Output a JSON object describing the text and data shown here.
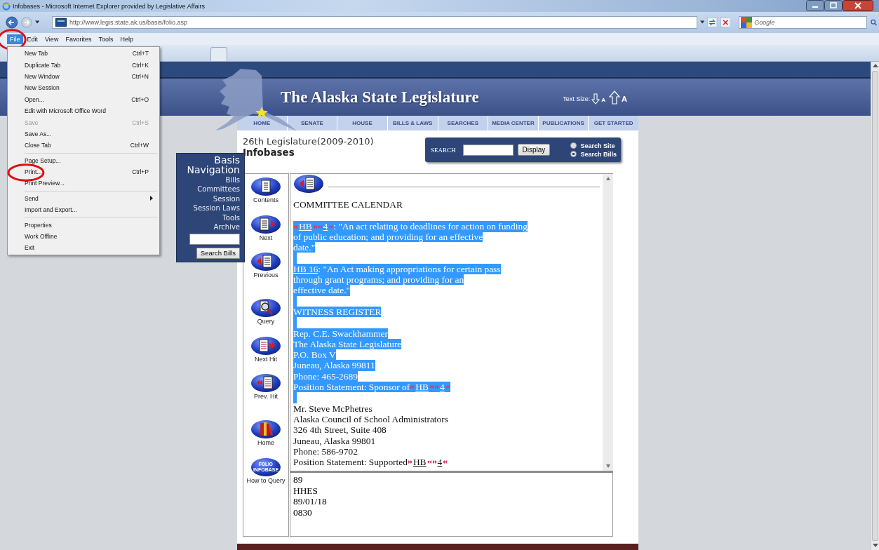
{
  "window": {
    "title": "Infobases - Microsoft Internet Explorer provided by Legislative Affairs"
  },
  "address_bar": {
    "url": "http://www.legis.state.ak.us/basis/folio.asp"
  },
  "search_box": {
    "placeholder": "Google"
  },
  "menu_bar": [
    {
      "label": "File",
      "selected": true,
      "circled": true
    },
    {
      "label": "Edit",
      "selected": false,
      "circled": false
    },
    {
      "label": "View",
      "selected": false,
      "circled": false
    },
    {
      "label": "Favorites",
      "selected": false,
      "circled": false
    },
    {
      "label": "Tools",
      "selected": false,
      "circled": false
    },
    {
      "label": "Help",
      "selected": false,
      "circled": false
    }
  ],
  "file_menu": {
    "groups": [
      [
        {
          "label": "New Tab",
          "shortcut": "Ctrl+T",
          "disabled": false,
          "submenu": false,
          "circled": false
        },
        {
          "label": "Duplicate Tab",
          "shortcut": "Ctrl+K",
          "disabled": false,
          "submenu": false,
          "circled": false
        },
        {
          "label": "New Window",
          "shortcut": "Ctrl+N",
          "disabled": false,
          "submenu": false,
          "circled": false
        },
        {
          "label": "New Session",
          "disabled": false,
          "submenu": false,
          "circled": false
        },
        {
          "label": "Open...",
          "shortcut": "Ctrl+O",
          "disabled": false,
          "submenu": false,
          "circled": false
        },
        {
          "label": "Edit with Microsoft Office Word",
          "disabled": false,
          "submenu": false,
          "circled": false
        },
        {
          "label": "Save",
          "shortcut": "Ctrl+S",
          "disabled": true,
          "submenu": false,
          "circled": false
        },
        {
          "label": "Save As...",
          "disabled": false,
          "submenu": false,
          "circled": false
        },
        {
          "label": "Close Tab",
          "shortcut": "Ctrl+W",
          "disabled": false,
          "submenu": false,
          "circled": false
        }
      ],
      [
        {
          "label": "Page Setup...",
          "disabled": false,
          "submenu": false,
          "circled": false
        },
        {
          "label": "Print...",
          "shortcut": "Ctrl+P",
          "disabled": false,
          "submenu": false,
          "circled": true
        },
        {
          "label": "Print Preview...",
          "disabled": false,
          "submenu": false,
          "circled": false
        }
      ],
      [
        {
          "label": "Send",
          "disabled": false,
          "submenu": true,
          "circled": false
        },
        {
          "label": "Import and Export...",
          "disabled": false,
          "submenu": false,
          "circled": false
        }
      ],
      [
        {
          "label": "Properties",
          "disabled": false,
          "submenu": false,
          "circled": false
        },
        {
          "label": "Work Offline",
          "disabled": false,
          "submenu": false,
          "circled": false
        },
        {
          "label": "Exit",
          "disabled": false,
          "submenu": false,
          "circled": false
        }
      ]
    ]
  },
  "site": {
    "title": "The Alaska State Legislature",
    "text_size": {
      "label": "Text Size:",
      "smaller": "A",
      "larger": "A"
    },
    "nav": [
      "HOME",
      "SENATE",
      "HOUSE",
      "BILLS & LAWS",
      "SEARCHES",
      "MEDIA CENTER",
      "PUBLICATIONS",
      "GET STARTED"
    ],
    "legislature": "26th Legislature(2009-2010)",
    "heading": "Infobases",
    "search": {
      "label": "SEARCH",
      "button": "Display",
      "options": [
        {
          "label": "Search Site",
          "selected": false
        },
        {
          "label": "Search Bills",
          "selected": true
        }
      ]
    }
  },
  "basis_navigation": {
    "title": "Basis Navigation",
    "links": [
      "Bills",
      "Committees",
      "Session",
      "Session Laws",
      "Tools",
      "Archive"
    ],
    "button": "Search Bills"
  },
  "tools": [
    {
      "kind": "contents",
      "label": "Contents"
    },
    {
      "kind": "next",
      "label": "Next"
    },
    {
      "kind": "previous",
      "label": "Previous"
    },
    {
      "kind": "query",
      "label": "Query"
    },
    {
      "kind": "next-hit",
      "label": "Next Hit"
    },
    {
      "kind": "prev-hit",
      "label": "Prev. Hit"
    },
    {
      "kind": "home",
      "label": "Home"
    },
    {
      "kind": "folio",
      "label": "How to Query",
      "logo_lines": [
        "FOLIO",
        "INFOBASE"
      ]
    }
  ],
  "document": {
    "lines": [
      {
        "selected": false,
        "segments": [
          {
            "kind": "text",
            "text": "COMMITTEE CALENDAR"
          }
        ]
      },
      {
        "selected": false
      },
      {
        "selected": true,
        "segments": [
          {
            "kind": "hit-open"
          },
          {
            "kind": "link",
            "text": "HB"
          },
          {
            "kind": "hit-close"
          },
          {
            "kind": "hit-open"
          },
          {
            "kind": "link",
            "text": "4"
          },
          {
            "kind": "hit-close"
          },
          {
            "kind": "text",
            "text": ": \"An act relating to deadlines for action on funding"
          }
        ]
      },
      {
        "selected": true,
        "segments": [
          {
            "kind": "text",
            "text": "of public education; and providing for an effective"
          }
        ]
      },
      {
        "selected": true,
        "segments": [
          {
            "kind": "text",
            "text": "date.\""
          }
        ]
      },
      {
        "selected": true
      },
      {
        "selected": true,
        "segments": [
          {
            "kind": "link",
            "text": "HB 16"
          },
          {
            "kind": "text",
            "text": " : \"An Act making appropriations for certain pass"
          }
        ]
      },
      {
        "selected": true,
        "segments": [
          {
            "kind": "text",
            "text": "through grant programs; and providing for an"
          }
        ]
      },
      {
        "selected": true,
        "segments": [
          {
            "kind": "text",
            "text": "effective date.\""
          }
        ]
      },
      {
        "selected": true
      },
      {
        "selected": true,
        "segments": [
          {
            "kind": "text",
            "text": "WITNESS REGISTER"
          }
        ]
      },
      {
        "selected": true
      },
      {
        "selected": true,
        "segments": [
          {
            "kind": "text",
            "text": "Rep. C.E. Swackhammer"
          }
        ]
      },
      {
        "selected": true,
        "segments": [
          {
            "kind": "text",
            "text": "The Alaska State Legislature"
          }
        ]
      },
      {
        "selected": true,
        "segments": [
          {
            "kind": "text",
            "text": "P.O. Box V"
          }
        ]
      },
      {
        "selected": true,
        "segments": [
          {
            "kind": "text",
            "text": "Juneau, Alaska 99811"
          }
        ]
      },
      {
        "selected": true,
        "segments": [
          {
            "kind": "text",
            "text": "Phone: 465-2689"
          }
        ]
      },
      {
        "selected": true,
        "segments": [
          {
            "kind": "text",
            "text": "Position Statement: Sponsor of"
          },
          {
            "kind": "hit-open"
          },
          {
            "kind": "link",
            "text": "HB"
          },
          {
            "kind": "hit-close"
          },
          {
            "kind": "hit-open"
          },
          {
            "kind": "link",
            "text": "4"
          },
          {
            "kind": "hit-close"
          }
        ]
      },
      {
        "selected": true
      },
      {
        "selected": false,
        "segments": [
          {
            "kind": "text",
            "text": "Mr. Steve McPhetres"
          }
        ]
      },
      {
        "selected": false,
        "segments": [
          {
            "kind": "text",
            "text": "Alaska Council of School Administrators"
          }
        ]
      },
      {
        "selected": false,
        "segments": [
          {
            "kind": "text",
            "text": "326 4th Street, Suite 408"
          }
        ]
      },
      {
        "selected": false,
        "segments": [
          {
            "kind": "text",
            "text": "Juneau, Alaska 99801"
          }
        ]
      },
      {
        "selected": false,
        "segments": [
          {
            "kind": "text",
            "text": "Phone: 586-9702"
          }
        ]
      },
      {
        "selected": false,
        "segments": [
          {
            "kind": "text",
            "text": "Position Statement: Supported"
          },
          {
            "kind": "hit-open"
          },
          {
            "kind": "link",
            "text": "HB"
          },
          {
            "kind": "hit-close"
          },
          {
            "kind": "hit-open"
          },
          {
            "kind": "link",
            "text": "4"
          },
          {
            "kind": "hit-close"
          }
        ]
      }
    ]
  },
  "info_pane": {
    "lines": [
      "89",
      "HHES",
      "89/01/18",
      "0830"
    ]
  }
}
